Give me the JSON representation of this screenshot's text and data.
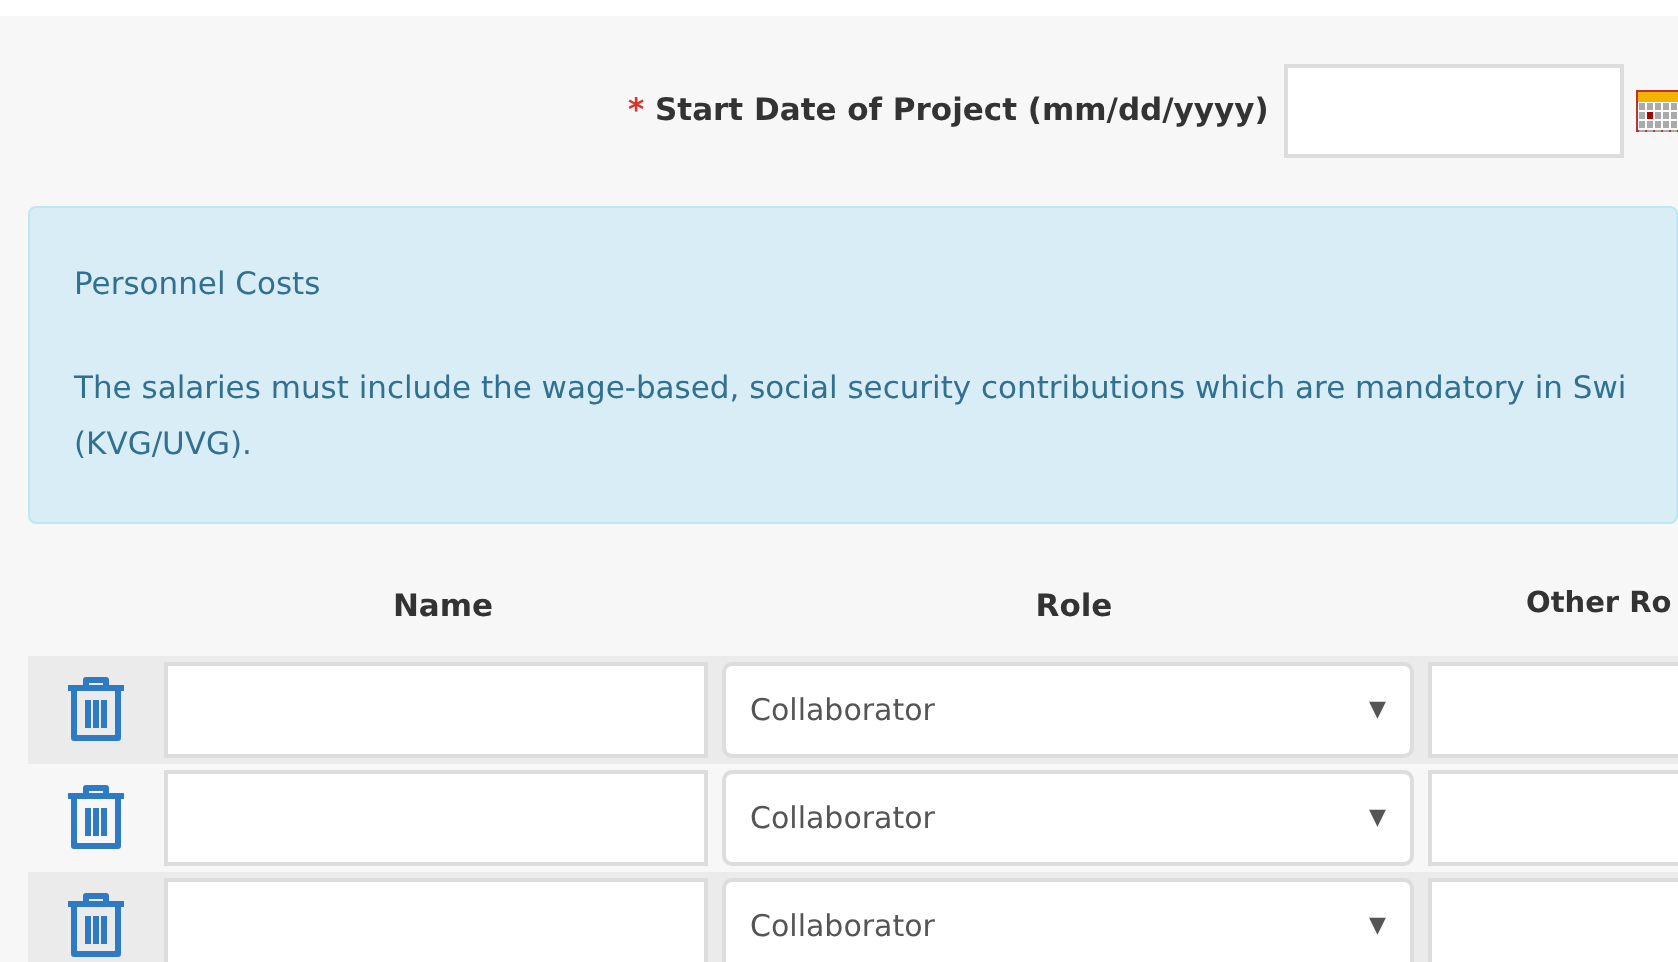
{
  "start_date": {
    "required_mark": "*",
    "label": "Start Date of Project (mm/dd/yyyy)"
  },
  "info_box": {
    "title": "Personnel Costs",
    "lines": [
      "The salaries must include the wage-based, social security contributions which are mandatory in Swi",
      "(KVG/UVG)."
    ]
  },
  "table": {
    "columns": [
      "Name",
      "Role",
      "Other Ro"
    ],
    "rows": [
      {
        "role": "Collaborator",
        "caret": "▼"
      },
      {
        "role": "Collaborator",
        "caret": "▼"
      },
      {
        "role": "Collaborator",
        "caret": "▼"
      }
    ]
  }
}
